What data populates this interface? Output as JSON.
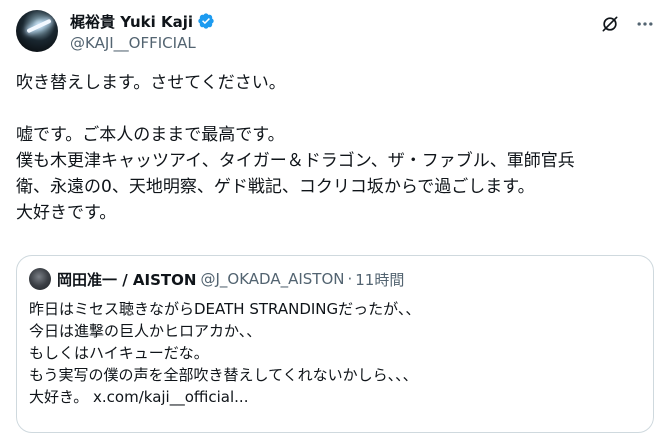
{
  "author": {
    "display_name": "梶裕貴 Yuki Kaji",
    "handle": "@KAJI__OFFICIAL",
    "verified_icon": "verified-badge-icon",
    "verified_color": "#1d9bf0"
  },
  "header_actions": {
    "grok_icon": "grok-icon",
    "more_icon": "more-icon"
  },
  "tweet": {
    "line1": "吹き替えします。させてください。",
    "line2": "嘘です。ご本人のままで最高です。",
    "line3": "僕も木更津キャッツアイ、タイガー＆ドラゴン、ザ・ファブル、軍師官兵",
    "line4": "衛、永遠の0、天地明察、ゲド戦記、コクリコ坂からで過ごします。",
    "line5": "大好きです。"
  },
  "quote": {
    "display_name": "岡田准一 / AISTON",
    "handle": "@J_OKADA_AISTON",
    "separator": "·",
    "time": "11時間",
    "line1": "昨日はミセス聴きながらDEATH STRANDINGだったが、、",
    "line2": "今日は進撃の巨人かヒロアカか、、",
    "line3": "もしくはハイキューだな。",
    "line4": "もう実写の僕の声を全部吹き替えしてくれないかしら、、、",
    "line5_text": "大好き。 ",
    "line5_link": "x.com/kaji__official..."
  },
  "colors": {
    "text_primary": "#0f1419",
    "text_secondary": "#536471",
    "border": "#cfd9de"
  }
}
